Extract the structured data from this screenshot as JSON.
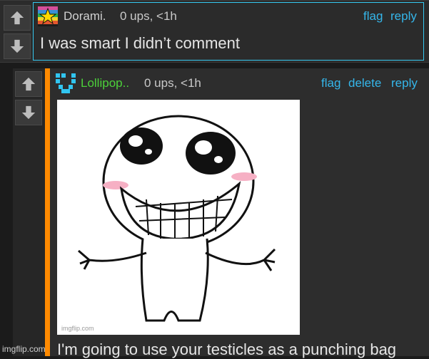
{
  "comment1": {
    "username": "Dorami.",
    "meta": "0 ups, <1h",
    "actions": {
      "flag": "flag",
      "reply": "reply"
    },
    "text": "I was smart I didn’t comment",
    "username_color": "#d0d0d0"
  },
  "comment2": {
    "username": "Lollipop..",
    "meta": "0 ups, <1h",
    "actions": {
      "flag": "flag",
      "delete": "delete",
      "reply": "reply"
    },
    "text": "I'm going to use your testicles as a punching bag",
    "username_color": "#4cd13a",
    "image_watermark": "imgflip.com"
  },
  "watermark": "imgflip.com",
  "colors": {
    "accent": "#35b6ea",
    "reply_bar": "#ff8a00"
  }
}
